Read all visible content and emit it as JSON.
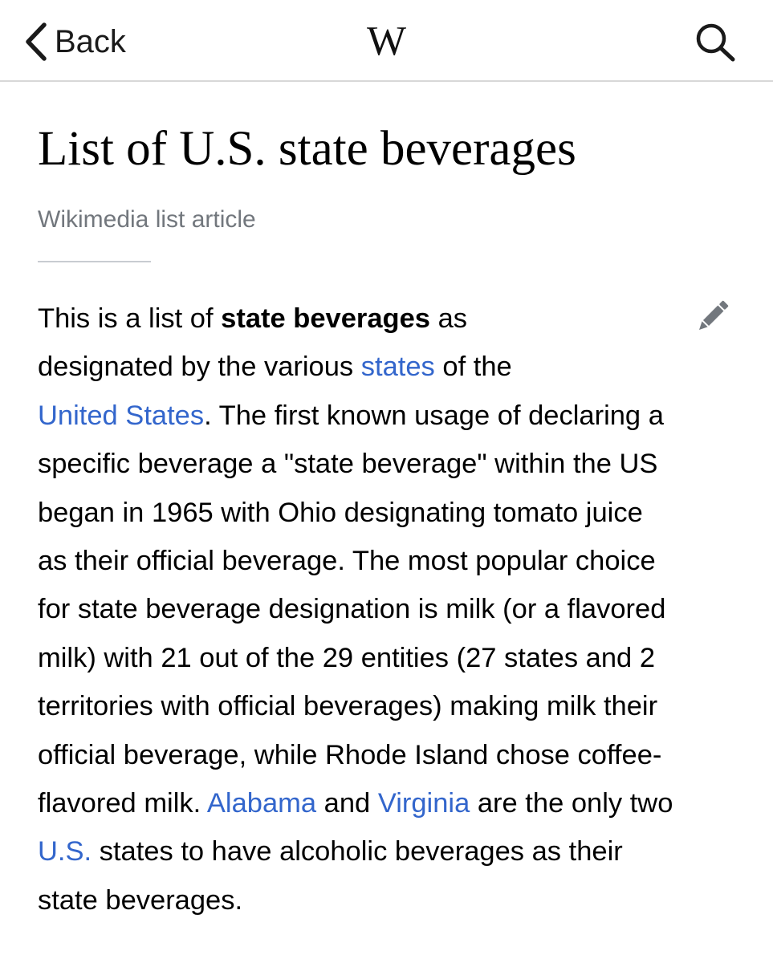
{
  "navbar": {
    "back_label": "Back",
    "logo_text": "W",
    "icons": {
      "back": "chevron-left-icon",
      "search": "search-icon",
      "edit": "pencil-icon"
    }
  },
  "article": {
    "title": "List of U.S. state beverages",
    "description": "Wikimedia list article",
    "intro": {
      "l1_before": "This is a list of ",
      "l1_bold": "state beverages",
      "l1_after": " as",
      "l2_before": "designated by the various ",
      "link_states": "states",
      "l2_after": " of the",
      "link_united_states": "United States",
      "l3_after": ". The first known usage of declaring a",
      "l4": "specific beverage a \"state beverage\" within the US",
      "l5": "began in 1965 with Ohio designating tomato juice",
      "l6": "as their official beverage. The most popular choice",
      "l7": "for state beverage designation is milk (or a flavored",
      "l8": "milk) with 21 out of the 29 entities (27 states and 2",
      "l9": "territories with official beverages) making milk their",
      "l10": "official beverage, while Rhode Island chose coffee-",
      "l11_before": "flavored milk. ",
      "link_alabama": "Alabama",
      "l11_mid": " and ",
      "link_virginia": "Virginia",
      "l11_after": " are the only two",
      "link_us": "U.S.",
      "l12_after": " states to have alcoholic beverages as their",
      "l13": "state beverages."
    }
  },
  "colors": {
    "link": "#3366cc",
    "description": "#72777d",
    "divider": "#c8ccd1",
    "icon": "#72777d",
    "text": "#000000"
  }
}
